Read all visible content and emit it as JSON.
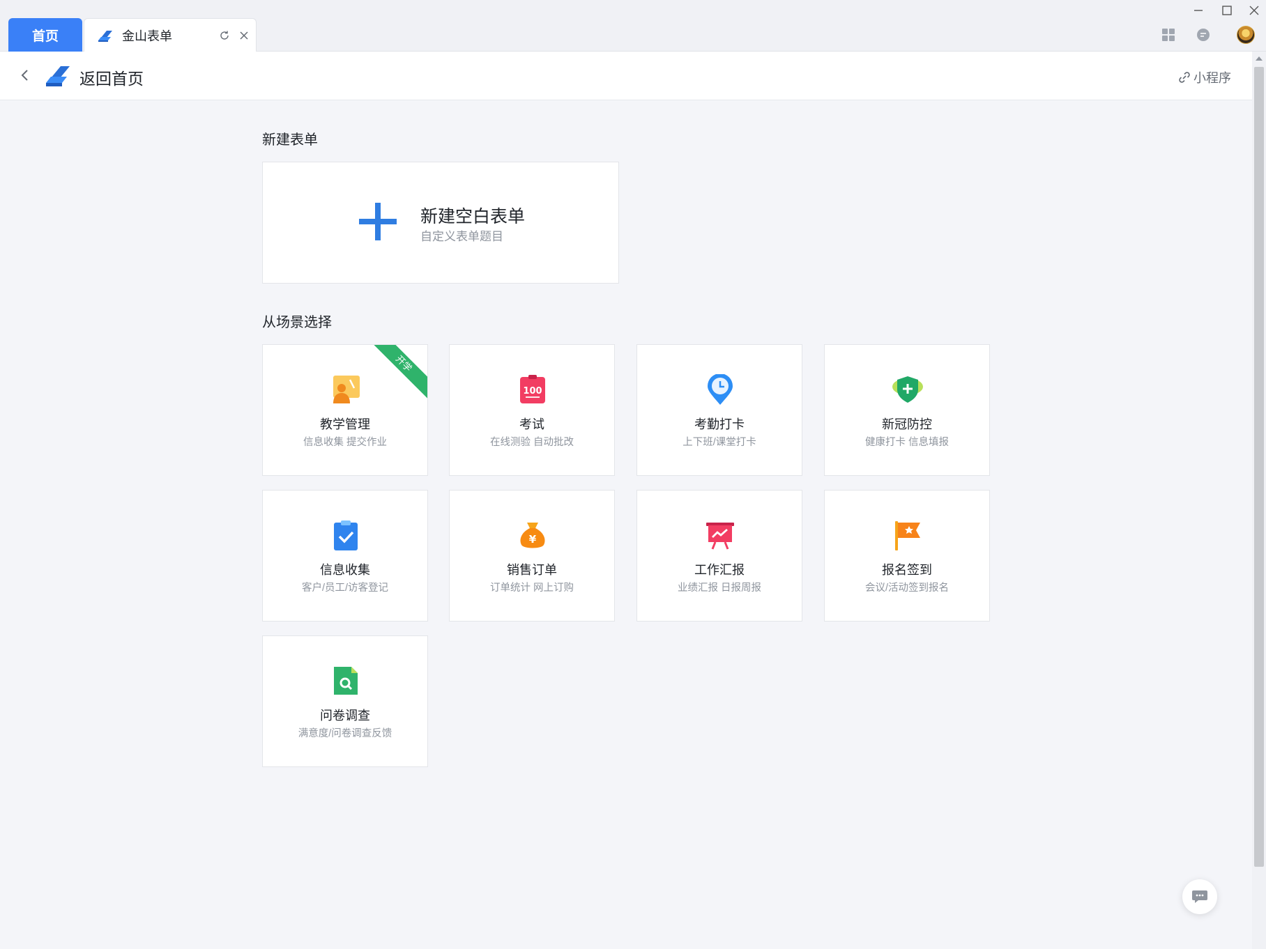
{
  "tabs": {
    "home_label": "首页",
    "doc_label": "金山表单"
  },
  "header": {
    "title": "返回首页",
    "mini_program": "小程序"
  },
  "new_section": {
    "title": "新建表单",
    "card_title": "新建空白表单",
    "card_subtitle": "自定义表单题目"
  },
  "scene_section": {
    "title": "从场景选择",
    "cards": [
      {
        "title": "教学管理",
        "subtitle": "信息收集 提交作业",
        "icon": "teaching-icon",
        "ribbon": "开学"
      },
      {
        "title": "考试",
        "subtitle": "在线测验 自动批改",
        "icon": "exam-icon",
        "badge_text": "100"
      },
      {
        "title": "考勤打卡",
        "subtitle": "上下班/课堂打卡",
        "icon": "clock-pin-icon"
      },
      {
        "title": "新冠防控",
        "subtitle": "健康打卡 信息填报",
        "icon": "shield-plus-icon"
      },
      {
        "title": "信息收集",
        "subtitle": "客户/员工/访客登记",
        "icon": "clipboard-check-icon"
      },
      {
        "title": "销售订单",
        "subtitle": "订单统计 网上订购",
        "icon": "money-bag-icon",
        "badge_text": "¥"
      },
      {
        "title": "工作汇报",
        "subtitle": "业绩汇报 日报周报",
        "icon": "presentation-icon"
      },
      {
        "title": "报名签到",
        "subtitle": "会议/活动签到报名",
        "icon": "flag-icon"
      },
      {
        "title": "问卷调查",
        "subtitle": "满意度/问卷调查反馈",
        "icon": "document-search-icon"
      }
    ]
  },
  "colors": {
    "accent": "#3a80f7",
    "plus": "#2f7de1",
    "ribbon": "#2fb36b"
  }
}
